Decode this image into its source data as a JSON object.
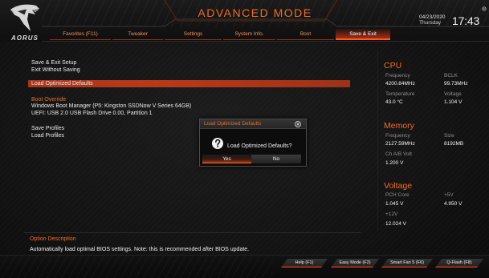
{
  "theme": {
    "accent": "#f26b22",
    "highlight": "#b9391a",
    "text": "#e9e9e9",
    "label": "#8f8f8f",
    "background": "#131313"
  },
  "header": {
    "brand": "AORUS",
    "title": "ADVANCED MODE",
    "date": "04/23/2020",
    "weekday": "Thursday",
    "time": "17:43",
    "icons": {
      "logo": "aorus-eagle-logo-icon",
      "settings": "settings-gear-icon"
    }
  },
  "tabs": [
    {
      "label": "Favorites (F11)",
      "active": false
    },
    {
      "label": "Tweaker",
      "active": false
    },
    {
      "label": "Settings",
      "active": false
    },
    {
      "label": "System Info.",
      "active": false
    },
    {
      "label": "Boot",
      "active": false
    },
    {
      "label": "Save & Exit",
      "active": true
    }
  ],
  "menu": {
    "items": [
      {
        "label": "Save & Exit Setup",
        "selected": false
      },
      {
        "label": "Exit Without Saving",
        "selected": false
      },
      {
        "label": "Load Optimized Defaults",
        "selected": true
      }
    ],
    "boot_override": {
      "heading": "Boot Override",
      "options": [
        "Windows Boot Manager (P5: Kingston SSDNow V Series 64GB)",
        "UEFI: USB 2.0 USB Flash Drive 0.00, Partition 1"
      ]
    },
    "profiles": [
      {
        "label": "Save Profiles"
      },
      {
        "label": "Load Profiles"
      }
    ]
  },
  "dialog": {
    "title": "Load Optimized Defaults",
    "message": "Load Optimized Defaults?",
    "buttons": [
      {
        "label": "Yes",
        "selected": true
      },
      {
        "label": "No",
        "selected": false
      }
    ],
    "icons": {
      "close": "close-icon",
      "prompt": "question-icon"
    }
  },
  "system_status": {
    "cpu": {
      "title": "CPU",
      "frequency": {
        "label": "Frequency",
        "value": "4200.84MHz"
      },
      "bclk": {
        "label": "BCLK",
        "value": "99.73MHz"
      },
      "temperature": {
        "label": "Temperature",
        "value": "43.0 °C"
      },
      "voltage": {
        "label": "Voltage",
        "value": "1.104 V"
      }
    },
    "memory": {
      "title": "Memory",
      "frequency": {
        "label": "Frequency",
        "value": "2127.59MHz"
      },
      "size": {
        "label": "Size",
        "value": "8192MB"
      },
      "ch_ab_volt": {
        "label": "Ch A/B Volt",
        "value": "1.200 V"
      }
    },
    "voltage": {
      "title": "Voltage",
      "pch_core": {
        "label": "PCH Core",
        "value": "1.045 V"
      },
      "plus_5v": {
        "label": "+5V",
        "value": "4.950 V"
      },
      "plus_12v": {
        "label": "+12V",
        "value": "12.024 V"
      }
    }
  },
  "option_description": {
    "title": "Option Description",
    "text": "Automatically load optimal BIOS settings. Note: this is recommended after BIOS update."
  },
  "footer": {
    "buttons": [
      {
        "label": "Help (F1)"
      },
      {
        "label": "Easy Mode (F2)"
      },
      {
        "label": "Smart Fan 5 (F6)"
      },
      {
        "label": "Q-Flash (F8)"
      }
    ]
  }
}
